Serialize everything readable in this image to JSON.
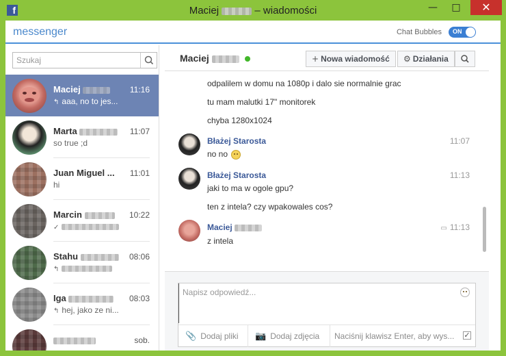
{
  "window": {
    "title_first": "Maciej",
    "title_suffix": "– wiadomości",
    "minimize": "—",
    "maximize": "□",
    "close": "✕"
  },
  "header": {
    "brand": "messenger",
    "chat_bubbles_label": "Chat Bubbles",
    "toggle_label": "ON"
  },
  "search": {
    "placeholder": "Szukaj"
  },
  "conversations": [
    {
      "name": "Maciej",
      "time": "11:16",
      "snippet": "aaa, no to jes...",
      "snippet_icon": "↰",
      "avatar_color": "#c26a62"
    },
    {
      "name": "Marta",
      "time": "11:07",
      "snippet": "so true ;d",
      "snippet_icon": "",
      "avatar_color": "#5a8a6a"
    },
    {
      "name": "Juan Miguel ...",
      "time": "11:01",
      "snippet": "hi",
      "snippet_icon": "",
      "avatar_color": "#9c7060"
    },
    {
      "name": "Marcin",
      "time": "10:22",
      "snippet": "",
      "snippet_icon": "✓",
      "avatar_color": "#6a6460"
    },
    {
      "name": "Stahu",
      "time": "08:06",
      "snippet": "",
      "snippet_icon": "↰",
      "avatar_color": "#4e6a4a"
    },
    {
      "name": "Iga",
      "time": "08:03",
      "snippet": "hej, jako ze ni...",
      "snippet_icon": "↰",
      "avatar_color": "#8a8a8a"
    },
    {
      "name": "",
      "time": "sob.",
      "snippet": "",
      "snippet_icon": "",
      "avatar_color": "#5a3a3a"
    }
  ],
  "chat": {
    "title": "Maciej",
    "new_message_label": "Nowa wiadomość",
    "actions_label": "Działania"
  },
  "messages": [
    {
      "kind": "line",
      "text": "odpalilem w domu na 1080p i dalo sie normalnie grac"
    },
    {
      "kind": "line",
      "text": "tu mam malutki 17\" monitorek"
    },
    {
      "kind": "line",
      "text": "chyba 1280x1024"
    },
    {
      "kind": "author",
      "author": "Błażej Starosta",
      "time": "11:07"
    },
    {
      "kind": "line",
      "text": "no no"
    },
    {
      "kind": "author",
      "author": "Błażej Starosta",
      "time": "11:13"
    },
    {
      "kind": "line",
      "text": "jaki to ma w ogole gpu?"
    },
    {
      "kind": "line",
      "text": "ten z intela? czy wpakowales cos?"
    },
    {
      "kind": "author",
      "author": "Maciej",
      "time": "11:13"
    },
    {
      "kind": "line",
      "text": "z intela"
    }
  ],
  "composer": {
    "placeholder": "Napisz odpowiedź...",
    "add_files": "Dodaj pliki",
    "add_photos": "Dodaj zdjęcia",
    "enter_hint": "Naciśnij klawisz Enter, aby wys..."
  }
}
